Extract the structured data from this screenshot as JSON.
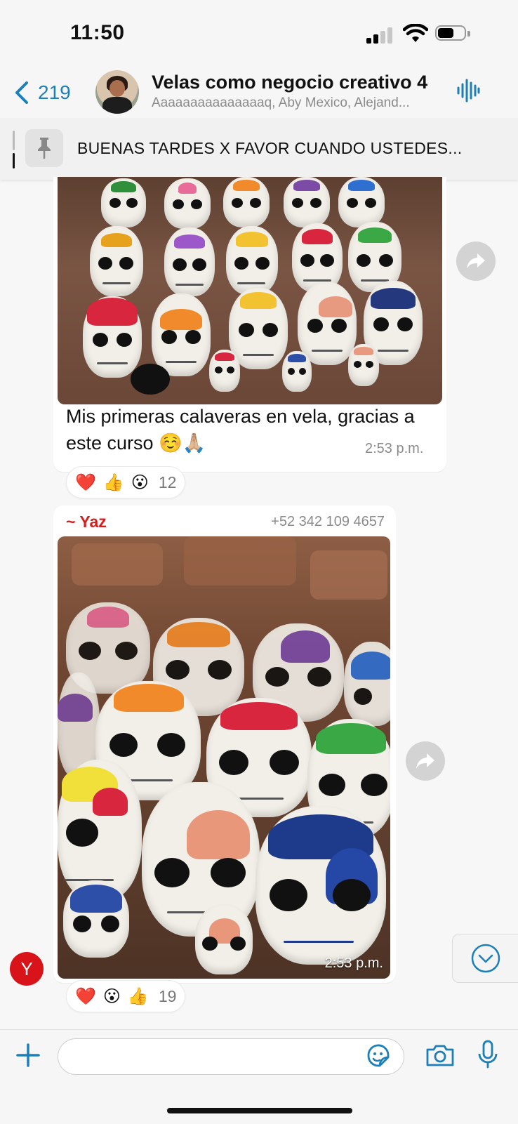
{
  "status": {
    "time": "11:50"
  },
  "header": {
    "back_count": "219",
    "title": "Velas como negocio creativo 4",
    "subtitle": "Aaaaaaaaaaaaaaaq, Aby Mexico, Alejand..."
  },
  "pinned": {
    "text": "BUENAS TARDES X FAVOR CUANDO USTEDES..."
  },
  "messages": [
    {
      "caption": "Mis primeras calaveras en vela, gracias a este curso ☺️🙏🏼",
      "time": "2:53 p.m.",
      "reactions": [
        "❤️",
        "👍",
        "😮"
      ],
      "reaction_count": "12"
    },
    {
      "sender": "~ Yaz",
      "phone": "+52 342 109 4657",
      "time": "2:53 p.m.",
      "reactions": [
        "❤️",
        "😮",
        "👍"
      ],
      "reaction_count": "19"
    }
  ],
  "avatar_initial": "Y",
  "icons": {
    "back": "chevron-left-icon",
    "voice": "audio-waveform-icon",
    "pin": "pin-icon",
    "forward": "forward-icon",
    "scroll_down": "chevron-down-icon",
    "plus": "plus-icon",
    "sticker": "sticker-icon",
    "camera": "camera-icon",
    "mic": "microphone-icon"
  },
  "colors": {
    "accent": "#1d7fb8",
    "sender": "#d51e1e",
    "avatar_bg": "#d8141a"
  }
}
